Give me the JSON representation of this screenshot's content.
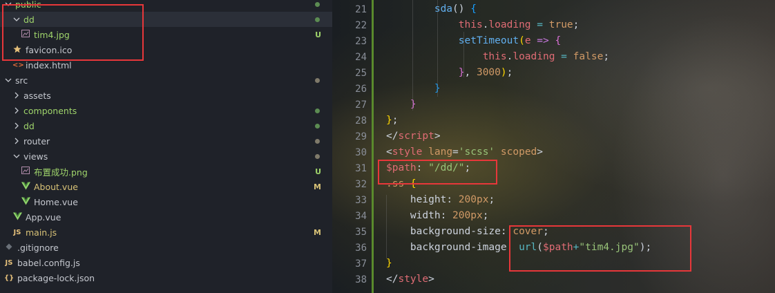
{
  "explorer": {
    "items": [
      {
        "label": "public",
        "kind": "folder",
        "open": true,
        "status": "dot-green",
        "selected": false
      },
      {
        "label": "dd",
        "kind": "folder",
        "open": true,
        "status": "dot-green",
        "selected": true
      },
      {
        "label": "tim4.jpg",
        "kind": "image",
        "status": "U",
        "selected": false
      },
      {
        "label": "favicon.ico",
        "kind": "star",
        "status": "",
        "selected": false
      },
      {
        "label": "index.html",
        "kind": "html",
        "status": "",
        "selected": false
      },
      {
        "label": "src",
        "kind": "folder",
        "open": true,
        "status": "dot-gray",
        "selected": false
      },
      {
        "label": "assets",
        "kind": "folder",
        "open": false,
        "status": "",
        "selected": false
      },
      {
        "label": "components",
        "kind": "folder",
        "open": false,
        "status": "dot-green",
        "selected": false
      },
      {
        "label": "dd",
        "kind": "folder",
        "open": false,
        "status": "dot-green",
        "selected": false
      },
      {
        "label": "router",
        "kind": "folder",
        "open": false,
        "status": "dot-gray",
        "selected": false
      },
      {
        "label": "views",
        "kind": "folder",
        "open": true,
        "status": "dot-gray",
        "selected": false
      },
      {
        "label": "布置成功.png",
        "kind": "image",
        "status": "U",
        "selected": false
      },
      {
        "label": "About.vue",
        "kind": "vue",
        "status": "M",
        "selected": false
      },
      {
        "label": "Home.vue",
        "kind": "vue",
        "status": "",
        "selected": false
      },
      {
        "label": "App.vue",
        "kind": "vue",
        "status": "",
        "selected": false
      },
      {
        "label": "main.js",
        "kind": "js",
        "status": "M",
        "selected": false
      },
      {
        "label": ".gitignore",
        "kind": "git",
        "status": "",
        "selected": false
      },
      {
        "label": "babel.config.js",
        "kind": "js",
        "status": "",
        "selected": false
      },
      {
        "label": "package-lock.json",
        "kind": "json",
        "status": "",
        "selected": false
      }
    ],
    "icons": {
      "image": "image-file-icon",
      "star": "favicon-star-icon",
      "html": "html-file-icon",
      "vue": "vue-file-icon",
      "js": "js-file-icon",
      "git": "git-file-icon",
      "json": "json-file-icon"
    },
    "icon_glyphs": {
      "html": "<>",
      "js": "JS",
      "json": "{}"
    }
  },
  "editor": {
    "lines": [
      {
        "n": "21",
        "tokens": [
          [
            "        ",
            "t-plain"
          ],
          [
            "sda",
            "t-func"
          ],
          [
            "() ",
            "t-plain"
          ],
          [
            "{",
            "t-br3"
          ]
        ]
      },
      {
        "n": "22",
        "tokens": [
          [
            "            ",
            "t-plain"
          ],
          [
            "this",
            "t-prop"
          ],
          [
            ".",
            "t-plain"
          ],
          [
            "loading",
            "t-prop"
          ],
          [
            " = ",
            "t-sym"
          ],
          [
            "true",
            "t-num"
          ],
          [
            ";",
            "t-plain"
          ]
        ]
      },
      {
        "n": "23",
        "tokens": [
          [
            "            ",
            "t-plain"
          ],
          [
            "setTimeout",
            "t-func"
          ],
          [
            "(",
            "t-br1"
          ],
          [
            "e ",
            "t-prop"
          ],
          [
            "=>",
            "t-kw"
          ],
          [
            " ",
            "t-plain"
          ],
          [
            "{",
            "t-br2"
          ]
        ]
      },
      {
        "n": "24",
        "tokens": [
          [
            "                ",
            "t-plain"
          ],
          [
            "this",
            "t-prop"
          ],
          [
            ".",
            "t-plain"
          ],
          [
            "loading",
            "t-prop"
          ],
          [
            " = ",
            "t-sym"
          ],
          [
            "false",
            "t-num"
          ],
          [
            ";",
            "t-plain"
          ]
        ]
      },
      {
        "n": "25",
        "tokens": [
          [
            "            ",
            "t-plain"
          ],
          [
            "}",
            "t-br2"
          ],
          [
            ", ",
            "t-plain"
          ],
          [
            "3000",
            "t-num"
          ],
          [
            ")",
            "t-br1"
          ],
          [
            ";",
            "t-plain"
          ]
        ]
      },
      {
        "n": "26",
        "tokens": [
          [
            "        ",
            "t-plain"
          ],
          [
            "}",
            "t-br3"
          ]
        ]
      },
      {
        "n": "27",
        "tokens": [
          [
            "    ",
            "t-plain"
          ],
          [
            "}",
            "t-br2"
          ]
        ]
      },
      {
        "n": "28",
        "tokens": [
          [
            "}",
            "t-br1"
          ],
          [
            ";",
            "t-plain"
          ]
        ]
      },
      {
        "n": "29",
        "tokens": [
          [
            "</",
            "t-plain"
          ],
          [
            "script",
            "t-tag"
          ],
          [
            ">",
            "t-plain"
          ]
        ]
      },
      {
        "n": "30",
        "tokens": [
          [
            "<",
            "t-plain"
          ],
          [
            "style ",
            "t-tag"
          ],
          [
            "lang",
            "t-num"
          ],
          [
            "=",
            "t-plain"
          ],
          [
            "'scss'",
            "t-str"
          ],
          [
            " scoped",
            "t-num"
          ],
          [
            ">",
            "t-plain"
          ]
        ]
      },
      {
        "n": "31",
        "tokens": [
          [
            "$path",
            "t-prop"
          ],
          [
            ": ",
            "t-plain"
          ],
          [
            "\"/dd/\"",
            "t-str"
          ],
          [
            ";",
            "t-plain"
          ]
        ]
      },
      {
        "n": "32",
        "tokens": [
          [
            ".ss ",
            "t-num"
          ],
          [
            "{",
            "t-br1"
          ]
        ]
      },
      {
        "n": "33",
        "tokens": [
          [
            "    ",
            "t-plain"
          ],
          [
            "height",
            "t-plain"
          ],
          [
            ": ",
            "t-plain"
          ],
          [
            "200px",
            "t-num"
          ],
          [
            ";",
            "t-plain"
          ]
        ]
      },
      {
        "n": "34",
        "tokens": [
          [
            "    ",
            "t-plain"
          ],
          [
            "width",
            "t-plain"
          ],
          [
            ": ",
            "t-plain"
          ],
          [
            "200px",
            "t-num"
          ],
          [
            ";",
            "t-plain"
          ]
        ]
      },
      {
        "n": "35",
        "tokens": [
          [
            "    ",
            "t-plain"
          ],
          [
            "background-size",
            "t-plain"
          ],
          [
            ": ",
            "t-plain"
          ],
          [
            "cover",
            "t-num"
          ],
          [
            ";",
            "t-plain"
          ]
        ]
      },
      {
        "n": "36",
        "tokens": [
          [
            "    ",
            "t-plain"
          ],
          [
            "background-image",
            "t-plain"
          ],
          [
            ": ",
            "t-plain"
          ],
          [
            "url",
            "t-sym"
          ],
          [
            "(",
            "t-plain"
          ],
          [
            "$path",
            "t-prop"
          ],
          [
            "+",
            "t-sym"
          ],
          [
            "\"tim4.jpg\"",
            "t-str"
          ],
          [
            ")",
            "t-plain"
          ],
          [
            ";",
            "t-plain"
          ]
        ]
      },
      {
        "n": "37",
        "tokens": [
          [
            "}",
            "t-br1"
          ]
        ]
      },
      {
        "n": "38",
        "tokens": [
          [
            "</",
            "t-plain"
          ],
          [
            "style",
            "t-tag"
          ],
          [
            ">",
            "t-plain"
          ]
        ]
      }
    ]
  },
  "colors": {
    "highlight_box": "#e8373a",
    "git_modified_bar": "#5a8a2c"
  }
}
